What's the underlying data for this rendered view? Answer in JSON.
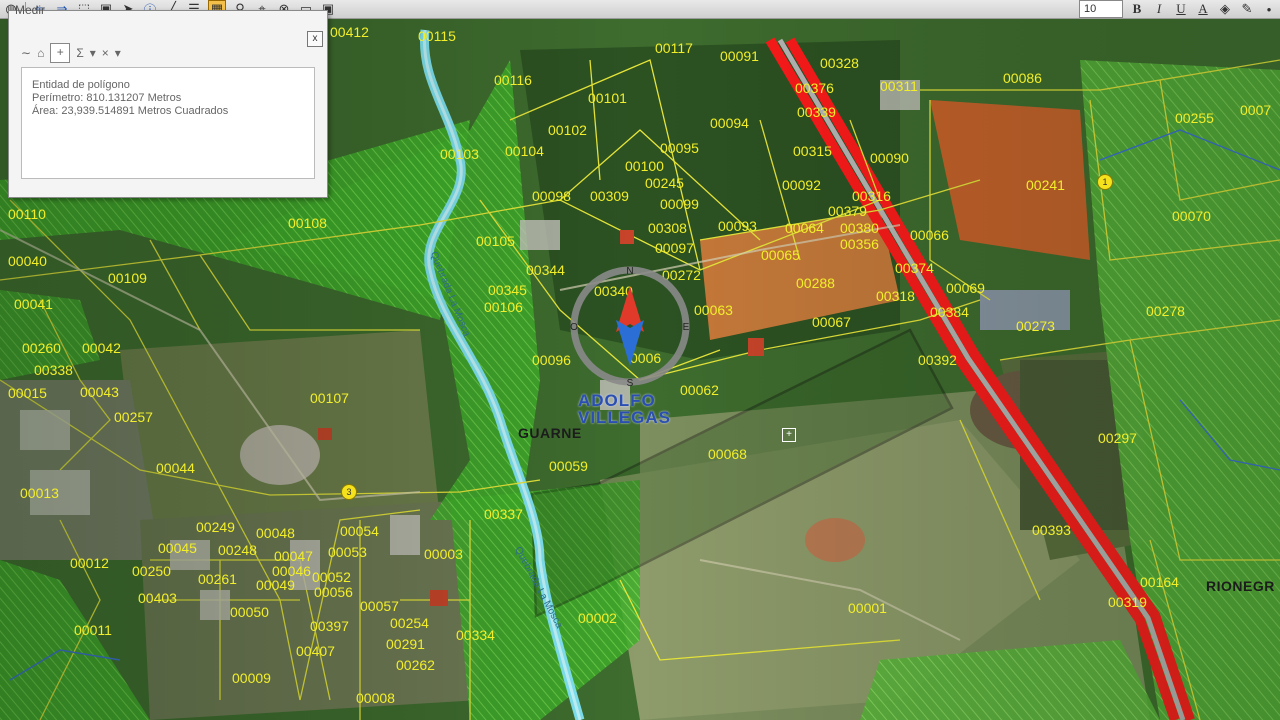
{
  "toolbar": {
    "font_size": "10",
    "bold": "B",
    "italic": "I",
    "underline": "U",
    "text_color": "A"
  },
  "measure_window": {
    "title": "Medir",
    "close": "x",
    "sum_symbol": "Σ",
    "clear_symbol": "×",
    "results": {
      "line1": "Entidad de polígono",
      "line2": "Perímetro: 810.131207 Metros",
      "line3": "Área: 23,939.514891 Metros Cuadrados"
    }
  },
  "place_labels": [
    "GUARNE",
    "RIONEGR"
  ],
  "stream_labels": [
    "Quebrada La Mosca"
  ],
  "brand": [
    "ADOLFO",
    "VILLEGAS"
  ],
  "compass": {
    "n": "N",
    "s": "S",
    "e": "E",
    "o": "O"
  },
  "markers": [
    "1",
    "3"
  ],
  "parcels": [
    "00412",
    "00115",
    "00117",
    "00091",
    "00328",
    "00086",
    "00255",
    "0007",
    "00116",
    "00101",
    "00376",
    "00311",
    "00102",
    "00094",
    "00339",
    "00103",
    "00104",
    "00095",
    "00315",
    "00090",
    "00241",
    "00100",
    "00245",
    "00092",
    "00316",
    "00110",
    "00108",
    "00098",
    "00309",
    "00099",
    "00379",
    "00070",
    "00308",
    "00093",
    "00064",
    "00380",
    "00066",
    "00105",
    "00097",
    "00356",
    "00040",
    "00109",
    "00344",
    "00272",
    "00065",
    "00374",
    "00345",
    "00340",
    "00288",
    "00318",
    "00069",
    "00041",
    "00106",
    "00063",
    "00384",
    "00273",
    "00278",
    "00067",
    "00260",
    "00042",
    "00096",
    "0006",
    "00392",
    "00338",
    "00043",
    "00062",
    "00015",
    "00107",
    "00257",
    "00297",
    "00068",
    "00044",
    "00059",
    "00013",
    "00249",
    "00048",
    "00054",
    "00045",
    "00248",
    "00047",
    "00053",
    "00003",
    "00393",
    "00012",
    "00250",
    "00046",
    "00052",
    "00261",
    "00049",
    "00403",
    "00050",
    "00056",
    "00057",
    "00164",
    "00319",
    "00002",
    "00001",
    "00011",
    "00397",
    "00254",
    "00334",
    "00291",
    "00407",
    "00262",
    "00009",
    "00008",
    "00337"
  ]
}
